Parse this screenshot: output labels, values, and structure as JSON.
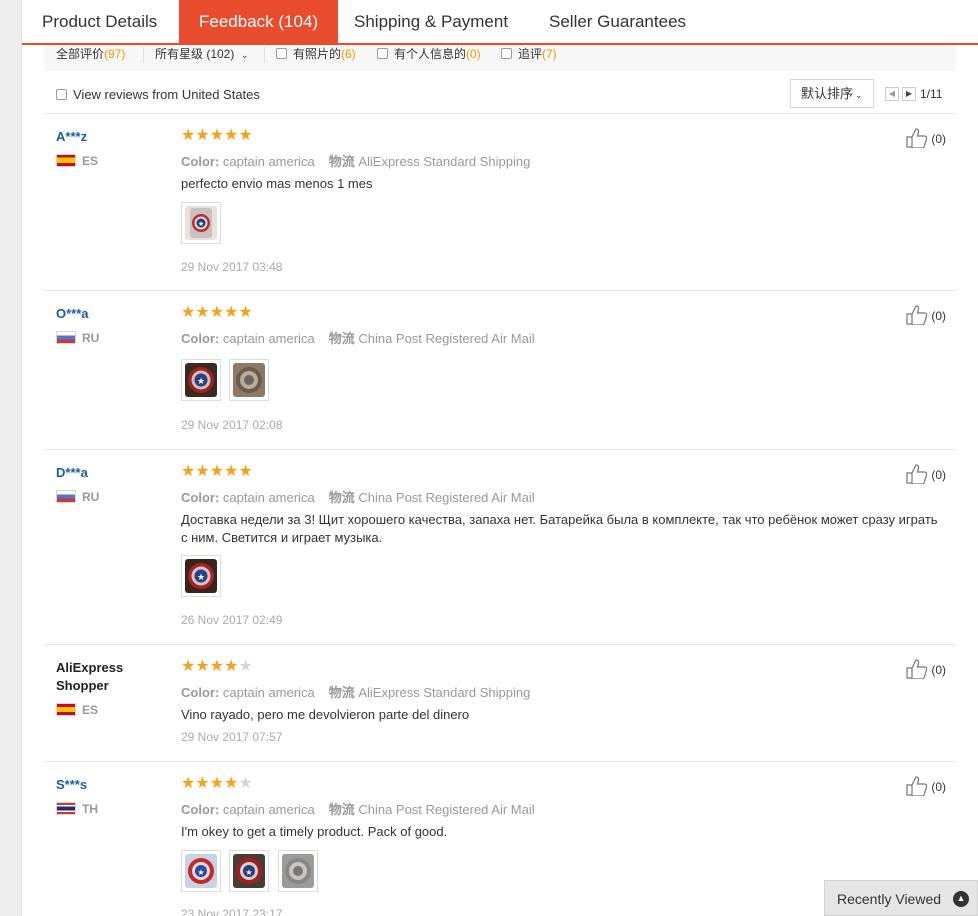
{
  "tabs": {
    "product": "Product Details",
    "feedback": "Feedback (104)",
    "shipping": "Shipping & Payment",
    "seller": "Seller Guarantees"
  },
  "filters": {
    "all_label": "全部评价",
    "all_count": "(97)",
    "star_label": "所有星级 (102)",
    "photo_label": "有照片的",
    "photo_count": "(6)",
    "info_label": "有个人信息的",
    "info_count": "(0)",
    "add_label": "追评",
    "add_count": "(7)"
  },
  "us_filter": "View reviews from United States",
  "sort_label": "默认排序",
  "pagination": "1/11",
  "color_label": "Color:",
  "logistics_label": "物流",
  "reviews": [
    {
      "user": "A***z",
      "country": "ES",
      "rating": 5,
      "color": "captain america",
      "shipping": "AliExpress Standard Shipping",
      "comment": "perfecto envio mas menos 1 mes",
      "photos": 1,
      "date": "29 Nov 2017 03:48",
      "helpful": "(0)"
    },
    {
      "user": "O***a",
      "country": "RU",
      "rating": 5,
      "color": "captain america",
      "shipping": "China Post Registered Air Mail",
      "comment": "",
      "photos": 2,
      "date": "29 Nov 2017 02:08",
      "helpful": "(0)"
    },
    {
      "user": "D***a",
      "country": "RU",
      "rating": 5,
      "color": "captain america",
      "shipping": "China Post Registered Air Mail",
      "comment": "Доставка недели за 3! Щит хорошего качества, запаха нет. Батарейка была в комплекте, так что ребёнок может сразу играть с ним. Светится и играет музыка.",
      "photos": 1,
      "date": "26 Nov 2017 02:49",
      "helpful": "(0)"
    },
    {
      "user": "AliExpress Shopper",
      "country": "ES",
      "rating": 4,
      "color": "captain america",
      "shipping": "AliExpress Standard Shipping",
      "comment": "Vino rayado, pero me devolvieron parte del dinero",
      "photos": 0,
      "date": "29 Nov 2017 07:57",
      "helpful": "(0)"
    },
    {
      "user": "S***s",
      "country": "TH",
      "rating": 4,
      "color": "captain america",
      "shipping": "China Post Registered Air Mail",
      "comment": "I'm okey to get a timely product. Pack of good.",
      "photos": 3,
      "date": "23 Nov 2017 23:17",
      "helpful": "(0)"
    }
  ],
  "recently_viewed": "Recently Viewed",
  "colors": {
    "accent": "#e94c2d",
    "star": "#f7a21b",
    "link": "#1a5ea8",
    "count": "#f39800"
  }
}
